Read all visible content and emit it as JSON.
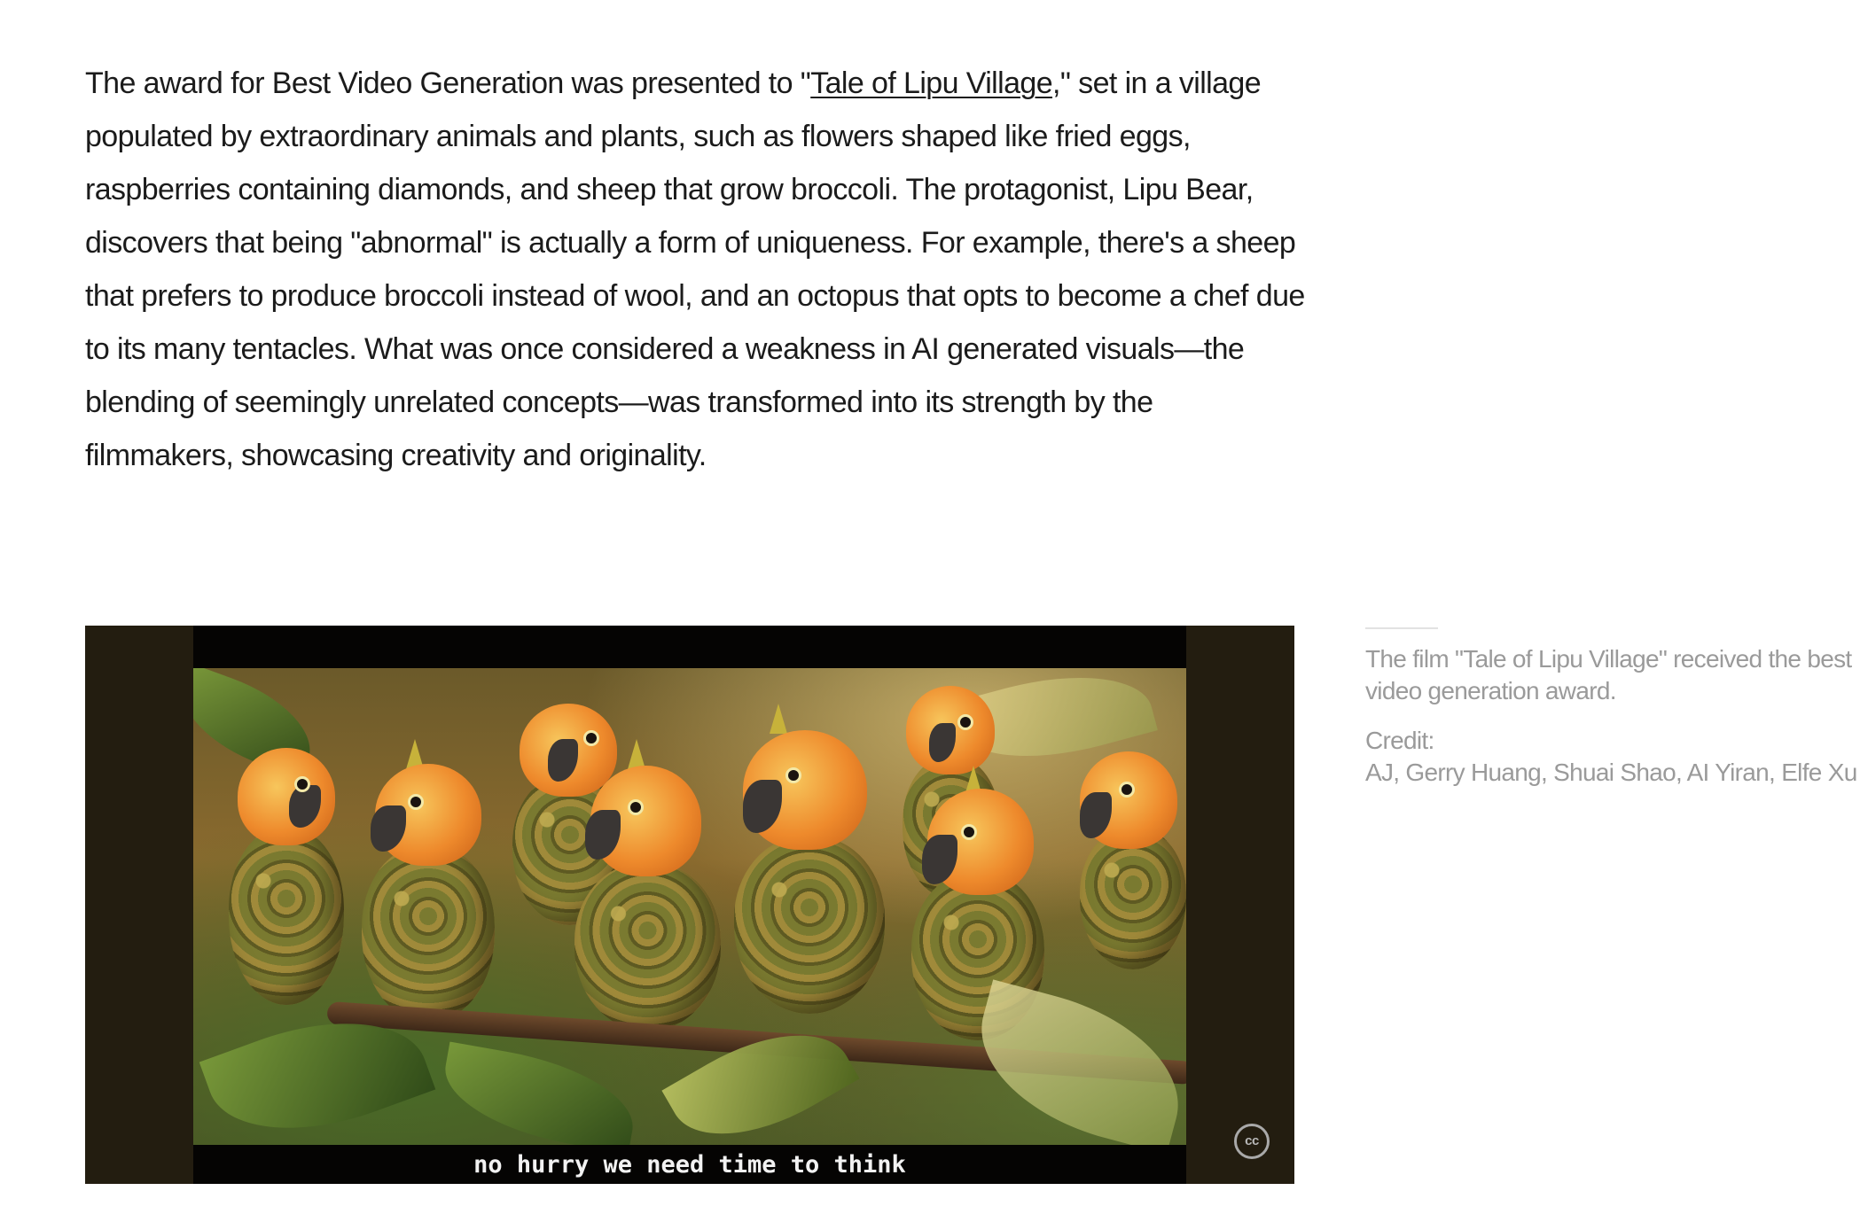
{
  "article": {
    "text_before_link": "The award for Best Video Generation was presented to \"",
    "link_text": "Tale of Lipu Village",
    "text_after_link": ",\" set in a village populated by extraordinary animals and plants, such as flowers shaped like fried eggs, raspberries containing diamonds, and sheep that grow broccoli. The protagonist, Lipu Bear, discovers that being \"abnormal\" is actually a form of uniqueness. For example, there's a sheep that prefers to produce broccoli instead of wool, and an octopus that opts to become a chef due to its many tentacles. What was once considered a weakness in AI generated visuals—the blending of seemingly unrelated concepts—was transformed into its strength by the filmmakers, showcasing creativity and originality."
  },
  "video": {
    "subtitle": "no hurry we need time to think",
    "cc_label": "cc",
    "cc_icon": "closed-captions-icon"
  },
  "figure_caption": {
    "text": "The film \"Tale of Lipu Village\" received the best video generation award.",
    "credit_label": "Credit:",
    "credit_names": "AJ, Gerry Huang, Shuai Shao, AI Yiran, Elfe Xu"
  }
}
